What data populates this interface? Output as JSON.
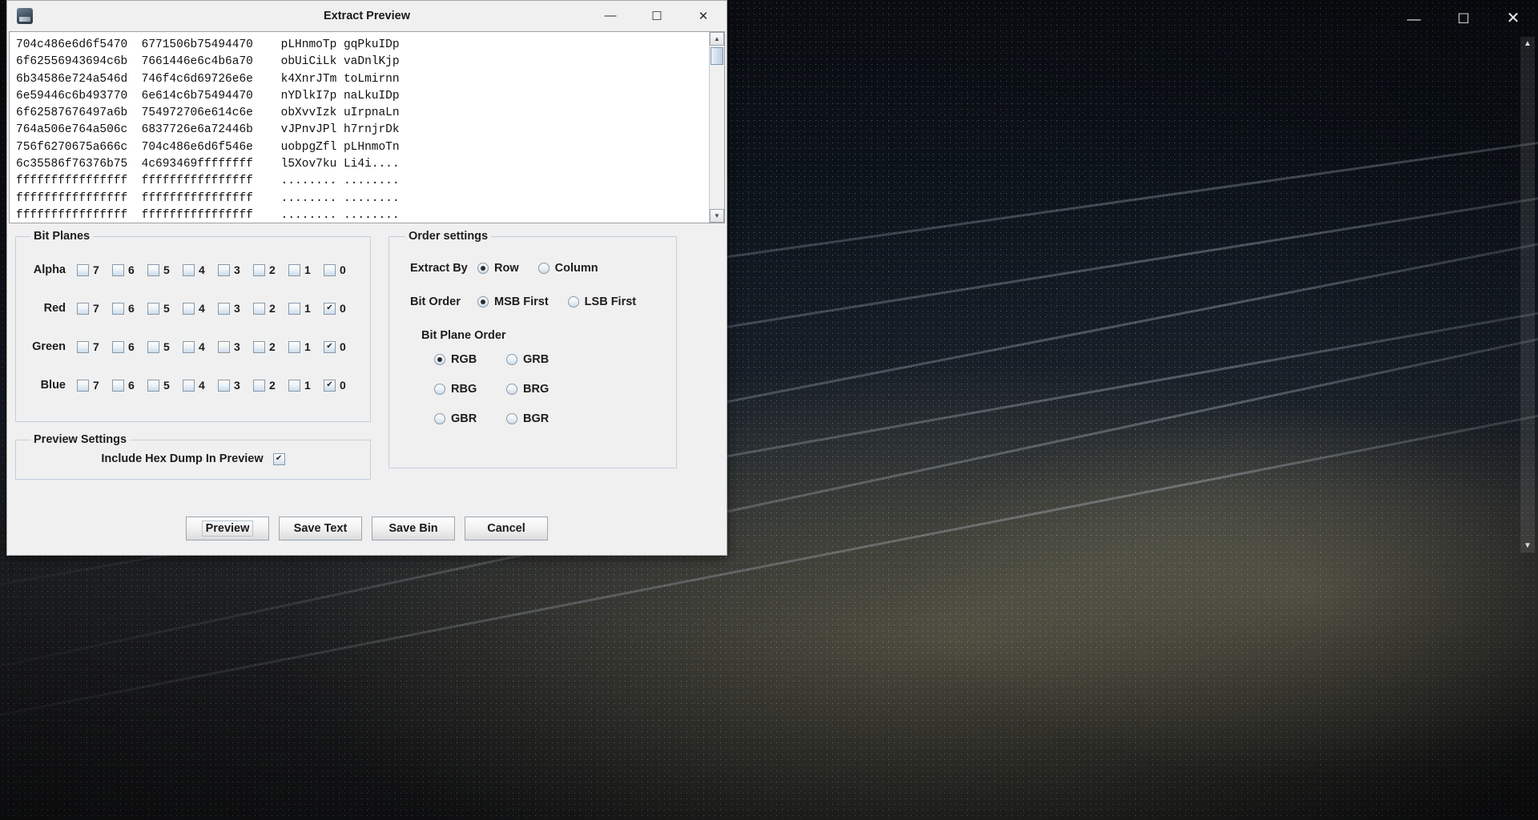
{
  "desktop": {
    "background_window": {
      "minimize_label": "—",
      "maximize_label": "☐",
      "close_label": "✕",
      "scroll_up_label": "▲",
      "scroll_down_label": "▼"
    }
  },
  "dialog": {
    "title": "Extract Preview",
    "icon": "app-image-icon",
    "window_controls": {
      "minimize": "—",
      "maximize": "☐",
      "close": "✕"
    },
    "preview": {
      "scroll_up": "▲",
      "scroll_down": "▼",
      "lines": [
        "704c486e6d6f5470  6771506b75494470    pLHnmoTp gqPkuIDp",
        "6f62556943694c6b  7661446e6c4b6a70    obUiCiLk vaDnlKjp",
        "6b34586e724a546d  746f4c6d69726e6e    k4XnrJTm toLmirnn",
        "6e59446c6b493770  6e614c6b75494470    nYDlkI7p naLkuIDp",
        "6f62587676497a6b  754972706e614c6e    obXvvIzk uIrpnaLn",
        "764a506e764a506c  6837726e6a72446b    vJPnvJPl h7rnjrDk",
        "756f6270675a666c  704c486e6d6f546e    uobpgZfl pLHnmoTn",
        "6c35586f76376b75  4c693469ffffffff    l5Xov7ku Li4i....",
        "ffffffffffffffff  ffffffffffffffff    ........ ........",
        "ffffffffffffffff  ffffffffffffffff    ........ ........",
        "ffffffffffffffff  ffffffffffffffff    ........ ........"
      ]
    },
    "bit_planes": {
      "legend": "Bit Planes",
      "bit_labels": [
        "7",
        "6",
        "5",
        "4",
        "3",
        "2",
        "1",
        "0"
      ],
      "rows": [
        {
          "channel": "Alpha",
          "checked": [
            false,
            false,
            false,
            false,
            false,
            false,
            false,
            false
          ]
        },
        {
          "channel": "Red",
          "checked": [
            false,
            false,
            false,
            false,
            false,
            false,
            false,
            true
          ]
        },
        {
          "channel": "Green",
          "checked": [
            false,
            false,
            false,
            false,
            false,
            false,
            false,
            true
          ]
        },
        {
          "channel": "Blue",
          "checked": [
            false,
            false,
            false,
            false,
            false,
            false,
            false,
            true
          ]
        }
      ]
    },
    "order_settings": {
      "legend": "Order settings",
      "extract_by": {
        "label": "Extract By",
        "options": [
          "Row",
          "Column"
        ],
        "selected": "Row"
      },
      "bit_order": {
        "label": "Bit Order",
        "options": [
          "MSB First",
          "LSB First"
        ],
        "selected": "MSB First"
      },
      "bit_plane_order": {
        "label": "Bit Plane Order",
        "options": [
          "RGB",
          "GRB",
          "RBG",
          "BRG",
          "GBR",
          "BGR"
        ],
        "selected": "RGB"
      }
    },
    "preview_settings": {
      "legend": "Preview Settings",
      "include_hex_dump": {
        "label": "Include Hex Dump In Preview",
        "checked": true
      }
    },
    "buttons": [
      {
        "label": "Preview",
        "focused": true
      },
      {
        "label": "Save Text",
        "focused": false
      },
      {
        "label": "Save Bin",
        "focused": false
      },
      {
        "label": "Cancel",
        "focused": false
      }
    ]
  },
  "colors": {
    "dialog_bg": "#f0f0f0",
    "group_border": "#c2cfdb",
    "text": "#1d1d1d",
    "preview_bg": "#ffffff"
  }
}
